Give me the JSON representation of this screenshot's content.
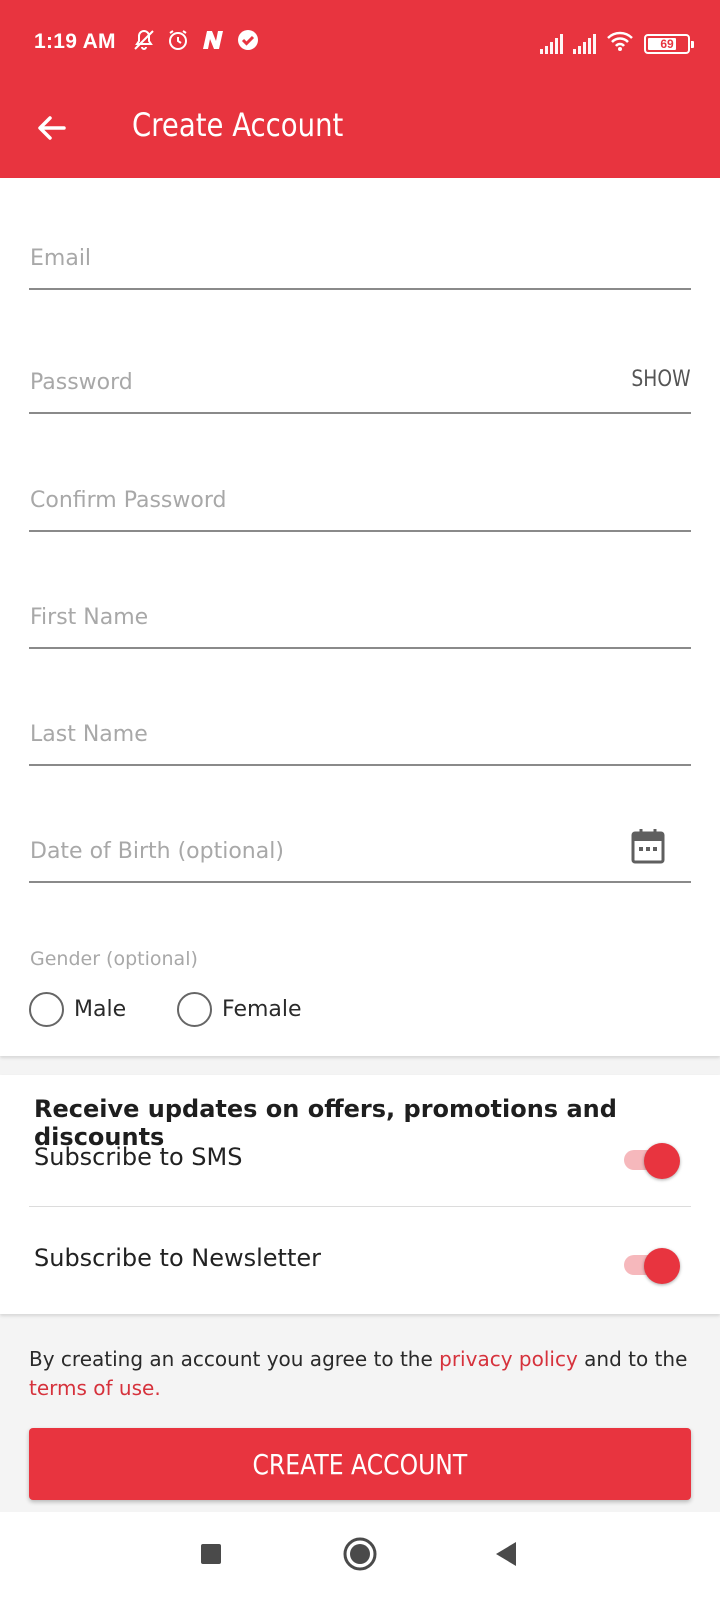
{
  "status_bar": {
    "time": "1:19 AM",
    "battery": "69",
    "icons_left": [
      "mute-icon",
      "alarm-icon",
      "n-app-icon",
      "check-circle-icon"
    ],
    "icons_right": [
      "signal-icon",
      "signal-icon",
      "wifi-icon",
      "battery-icon"
    ]
  },
  "app_bar": {
    "title": "Create Account",
    "back_icon": "arrow-left-icon"
  },
  "form": {
    "email_placeholder": "Email",
    "password_placeholder": "Password",
    "password_show_label": "SHOW",
    "confirm_password_placeholder": "Confirm Password",
    "first_name_placeholder": "First Name",
    "last_name_placeholder": "Last Name",
    "dob_placeholder": "Date of Birth (optional)",
    "calendar_icon": "calendar-icon",
    "gender_label": "Gender (optional)",
    "gender_options": [
      "Male",
      "Female"
    ]
  },
  "subscriptions": {
    "heading": "Receive updates on offers, promotions and discounts",
    "sms_label": "Subscribe to SMS",
    "sms_enabled": true,
    "newsletter_label": "Subscribe to Newsletter",
    "newsletter_enabled": true
  },
  "agreement": {
    "text_before": "By creating an account you agree to the ",
    "privacy_link": "privacy policy",
    "text_middle": " and to the ",
    "terms_link": "terms of use."
  },
  "create_button_label": "CREATE ACCOUNT",
  "colors": {
    "accent": "#e8343f",
    "link": "#d6323c"
  },
  "nav_bar": {
    "icons": [
      "recents-square-icon",
      "home-circle-icon",
      "back-triangle-icon"
    ]
  }
}
